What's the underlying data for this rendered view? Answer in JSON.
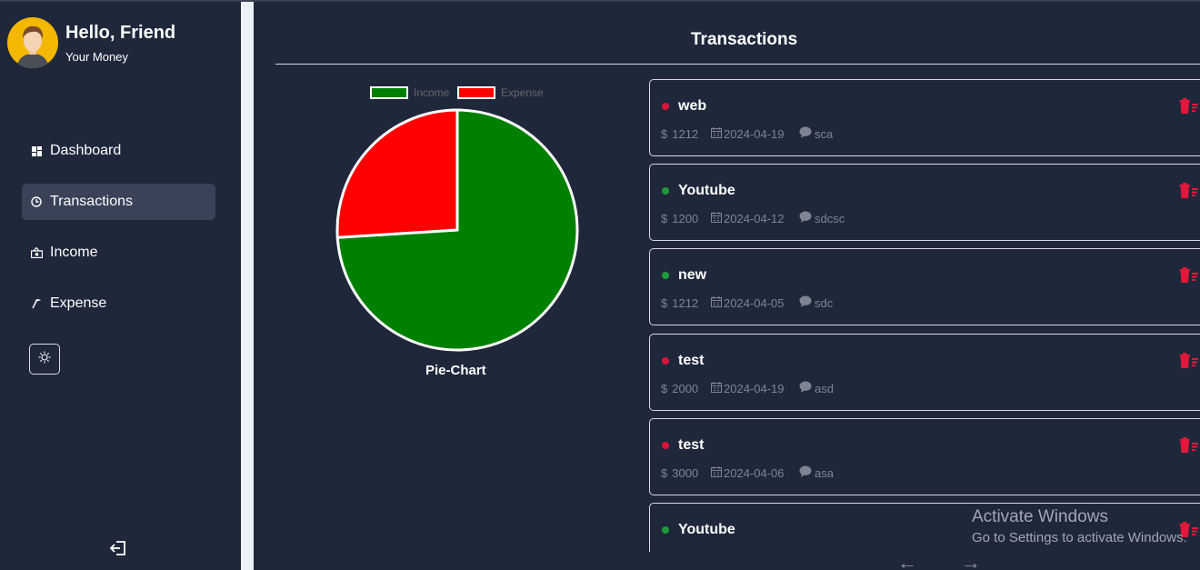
{
  "user": {
    "greeting": "Hello, Friend",
    "subtitle": "Your Money"
  },
  "nav": [
    {
      "label": "Dashboard",
      "icon": "dashboard-icon",
      "active": false
    },
    {
      "label": "Transactions",
      "icon": "transactions-icon",
      "active": true
    },
    {
      "label": "Income",
      "icon": "income-icon",
      "active": false
    },
    {
      "label": "Expense",
      "icon": "expense-icon",
      "active": false
    }
  ],
  "page": {
    "title": "Transactions"
  },
  "chart_data": {
    "type": "pie",
    "title": "Pie-Chart",
    "labels": [
      "Income",
      "Expense"
    ],
    "values": [
      74,
      26
    ],
    "colors": [
      "#008000",
      "#ff0000"
    ],
    "legend_position": "top"
  },
  "currency_symbol": "$",
  "transactions": [
    {
      "name": "web",
      "amount": "1212",
      "date": "2024-04-19",
      "note": "sca",
      "type": "expense"
    },
    {
      "name": "Youtube",
      "amount": "1200",
      "date": "2024-04-12",
      "note": "sdcsc",
      "type": "income"
    },
    {
      "name": "new",
      "amount": "1212",
      "date": "2024-04-05",
      "note": "sdc",
      "type": "income"
    },
    {
      "name": "test",
      "amount": "2000",
      "date": "2024-04-19",
      "note": "asd",
      "type": "expense"
    },
    {
      "name": "test",
      "amount": "3000",
      "date": "2024-04-06",
      "note": "asa",
      "type": "expense"
    },
    {
      "name": "Youtube",
      "amount": "",
      "date": "",
      "note": "",
      "type": "income"
    }
  ],
  "colors": {
    "income": "#1f9a3a",
    "expense": "#dc143c",
    "delete": "#e0193a"
  },
  "watermark": {
    "line1": "Activate Windows",
    "line2": "Go to Settings to activate Windows."
  }
}
